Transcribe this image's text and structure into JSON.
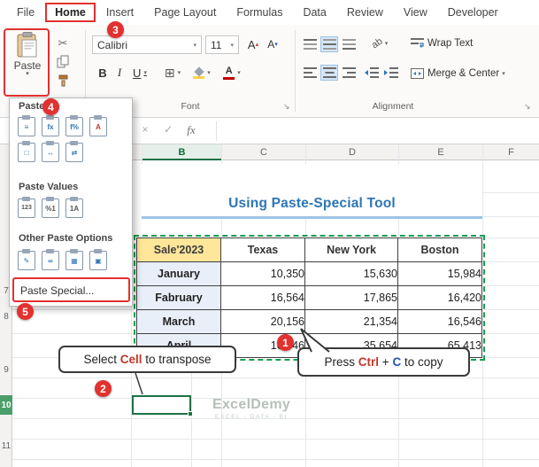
{
  "app": {
    "tabs": [
      {
        "id": "file",
        "label": "File"
      },
      {
        "id": "home",
        "label": "Home",
        "active": true
      },
      {
        "id": "insert",
        "label": "Insert"
      },
      {
        "id": "page-layout",
        "label": "Page Layout"
      },
      {
        "id": "formulas",
        "label": "Formulas"
      },
      {
        "id": "data",
        "label": "Data"
      },
      {
        "id": "review",
        "label": "Review"
      },
      {
        "id": "view",
        "label": "View"
      },
      {
        "id": "developer",
        "label": "Developer"
      }
    ]
  },
  "ribbon": {
    "paste_label": "Paste",
    "font_name": "Calibri",
    "font_size": "11",
    "bold": "B",
    "italic": "I",
    "underline": "U",
    "grow_font": "A",
    "shrink_font": "A",
    "font_color_letter": "A",
    "orientation_label": "ab",
    "wrap_text_label": "Wrap Text",
    "merge_center_label": "Merge & Center",
    "font_group_label": "Font",
    "alignment_group_label": "Alignment"
  },
  "icons": {
    "cut": "✂",
    "borders": "⊞",
    "cancel": "×",
    "enter": "✓"
  },
  "formula_bar": {
    "fx": "fx"
  },
  "paste_menu": {
    "section_paste": "Paste",
    "section_values": "Paste Values",
    "section_other": "Other Paste Options",
    "paste_special": "Paste Special...",
    "glyphs": {
      "paste": "≡",
      "formulas": "fx",
      "formulas_nf": "f%",
      "keep_fmt": "A",
      "no_borders": "□",
      "col_widths": "↔",
      "transpose": "⇄",
      "values": "123",
      "values_nf": "%1",
      "values_fmt": "1A",
      "formatting": "✎",
      "link": "∞",
      "picture": "▦",
      "linked_picture": "▣"
    }
  },
  "badges": {
    "b1": "1",
    "b2": "2",
    "b3": "3",
    "b4": "4",
    "b5": "5"
  },
  "grid": {
    "columns": [
      "B",
      "C",
      "D",
      "E",
      "F"
    ],
    "rows": [
      "7",
      "8",
      "9",
      "10",
      "11"
    ]
  },
  "sheet": {
    "title": "Using Paste-Special Tool",
    "table": {
      "headers": [
        "Sale'2023",
        "Texas",
        "New York",
        "Boston"
      ],
      "rows": [
        {
          "month": "January",
          "texas": "10,350",
          "new_york": "15,630",
          "boston": "15,984"
        },
        {
          "month": "Fabruary",
          "texas": "16,564",
          "new_york": "17,865",
          "boston": "16,420"
        },
        {
          "month": "March",
          "texas": "20,156",
          "new_york": "21,354",
          "boston": "16,546"
        },
        {
          "month": "April",
          "texas": "16,546",
          "new_york": "35,654",
          "boston": "65,413"
        }
      ]
    }
  },
  "callouts": {
    "select": {
      "pre": "Select ",
      "key": "Cell",
      "post": " to transpose"
    },
    "copy": {
      "pre": "Press ",
      "key1": "Ctrl",
      "sep": " + ",
      "key2": "C",
      "post": " to copy"
    }
  },
  "watermark": {
    "name": "ExcelDemy",
    "tagline": "EXCEL - DATA - BI"
  },
  "colors": {
    "annotation_red": "#e2312f",
    "excel_green": "#1e7145",
    "dashed_green": "#14a050",
    "title_blue": "#2e75b6",
    "key_red": "#c0392b",
    "key_blue": "#2257b0",
    "header_tan": "#ffe699",
    "month_blue": "#e9eff8"
  }
}
